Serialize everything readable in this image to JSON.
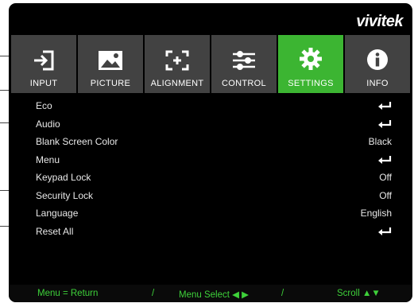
{
  "brand": "vivitek",
  "tabs": [
    {
      "label": "INPUT",
      "icon": "input-icon",
      "active": false
    },
    {
      "label": "PICTURE",
      "icon": "picture-icon",
      "active": false
    },
    {
      "label": "ALIGNMENT",
      "icon": "alignment-icon",
      "active": false
    },
    {
      "label": "CONTROL",
      "icon": "sliders-icon",
      "active": false
    },
    {
      "label": "SETTINGS",
      "icon": "gear-icon",
      "active": true
    },
    {
      "label": "INFO",
      "icon": "info-icon",
      "active": false
    }
  ],
  "menu": [
    {
      "label": "Eco",
      "value": "",
      "enter": true
    },
    {
      "label": "Audio",
      "value": "",
      "enter": true
    },
    {
      "label": "Blank Screen Color",
      "value": "Black",
      "enter": false
    },
    {
      "label": "Menu",
      "value": "",
      "enter": true
    },
    {
      "label": "Keypad Lock",
      "value": "Off",
      "enter": false
    },
    {
      "label": "Security Lock",
      "value": "Off",
      "enter": false
    },
    {
      "label": "Language",
      "value": "English",
      "enter": false
    },
    {
      "label": "Reset All",
      "value": "",
      "enter": true
    }
  ],
  "footer": {
    "menu_return": "Menu = Return",
    "sep1": "/",
    "menu_select": "Menu Select ◀ ▶",
    "sep2": "/",
    "scroll": "Scroll ▲▼"
  },
  "colors": {
    "active_tab": "#3cb532",
    "tab_bg": "#424242",
    "footer_text": "#3ed13a"
  }
}
